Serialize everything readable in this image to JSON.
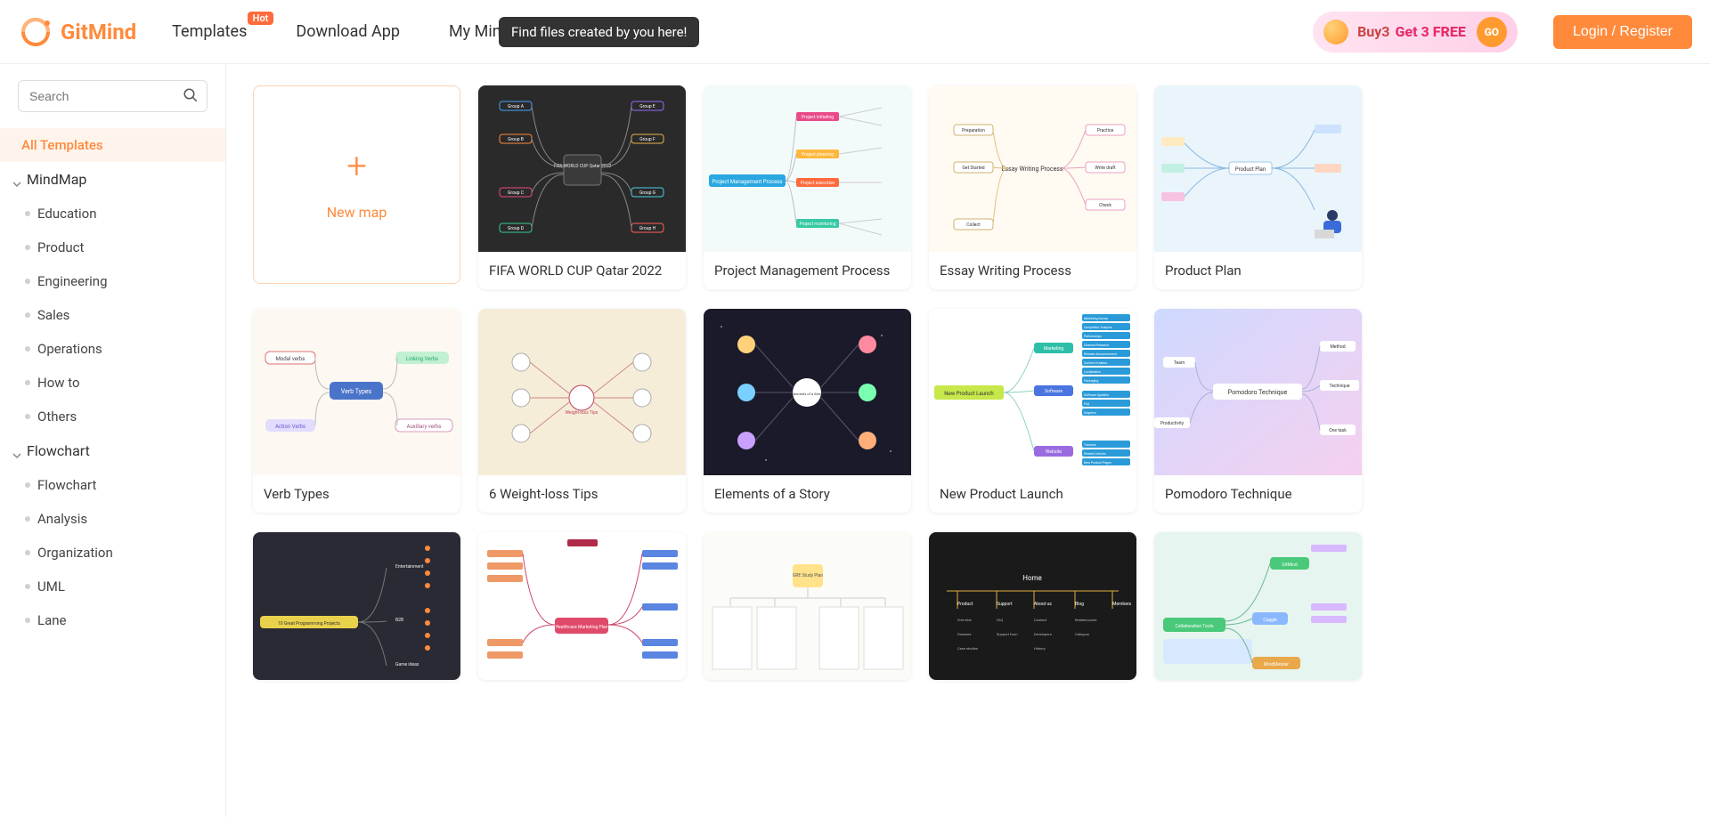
{
  "header": {
    "brand": "GitMind",
    "nav": {
      "templates": "Templates",
      "templates_badge": "Hot",
      "download": "Download App",
      "my_mind": "My Mind Maps"
    },
    "tooltip": "Find files created by you here!",
    "promo": {
      "part1": "Buy3",
      "part2": "Get 3 FREE",
      "go": "GO"
    },
    "login": "Login / Register"
  },
  "sidebar": {
    "search_placeholder": "Search",
    "all_templates": "All Templates",
    "groups": [
      {
        "name": "MindMap",
        "items": [
          "Education",
          "Product",
          "Engineering",
          "Sales",
          "Operations",
          "How to",
          "Others"
        ]
      },
      {
        "name": "Flowchart",
        "items": [
          "Flowchart",
          "Analysis",
          "Organization",
          "UML",
          "Lane"
        ]
      }
    ]
  },
  "grid": {
    "new_map": "New map",
    "cards_row1": [
      "FIFA WORLD CUP Qatar 2022",
      "Project Management Process",
      "Essay Writing Process",
      "Product Plan"
    ],
    "cards_row2": [
      "Verb Types",
      "6 Weight-loss Tips",
      "Elements of a Story",
      "New Product Launch",
      "Pomodoro Technique"
    ]
  },
  "thumbs": {
    "t1": {
      "center": "FIFA WORLD CUP\nQatar 2022",
      "left": [
        "Group A",
        "Group B",
        "Group C",
        "Group D"
      ],
      "right": [
        "Group E",
        "Group F",
        "Group G",
        "Group H"
      ]
    },
    "t2": {
      "center": "Project Management Process",
      "nodes": [
        "Project initiating",
        "Project planning",
        "Project execution",
        "Project monitoring"
      ]
    },
    "t3": {
      "center": "Essay Writing Process",
      "left": [
        "Preparation",
        "Get Started",
        "Collect"
      ],
      "right": [
        "Practice",
        "Write draft",
        "Check"
      ]
    },
    "t4": {
      "center": "Product Plan"
    },
    "t5": {
      "center": "Verb Types",
      "nodes": [
        "Modal verbs",
        "Linking Verbs",
        "Action Verbs",
        "Auxiliary verbs"
      ]
    },
    "t6": {
      "center": "Weight-loss Tips"
    },
    "t7": {
      "center": "Elements of a Story"
    },
    "t8": {
      "center": "New Product Launch",
      "branches": [
        "Marketing",
        "Software",
        "Website"
      ],
      "marketing_items": [
        "Marketing Survey",
        "Competitor Analysis",
        "Partnerships",
        "Channel Research",
        "Release Announcement",
        "Content Creation",
        "Localisation",
        "Packaging"
      ],
      "software_items": [
        "Software Updates",
        "FAQ",
        "Graphics"
      ],
      "website_items": [
        "Tutorials",
        "Related Articles",
        "New Product Pages"
      ]
    },
    "t9": {
      "center": "Pomodoro Technique",
      "nodes": [
        "Team",
        "Method",
        "One task",
        "Technique",
        "Productivity"
      ]
    },
    "t10": {
      "center": "10 Great Programming Projects",
      "branches": [
        "Entertainment",
        "B2B",
        "Game ideas"
      ]
    },
    "t11": {
      "center": "Healthcare Marketing Plan"
    },
    "t12": {
      "center": "GRE\nStudy Plan"
    },
    "t13": {
      "center": "Home",
      "cols": [
        "Product",
        "Support",
        "About us",
        "Blog",
        "Members"
      ],
      "rows": [
        [
          "Free trial",
          "FAQ",
          "Contact",
          "Related posts",
          ""
        ],
        [
          "Features",
          "Support form",
          "Developers",
          "Category",
          ""
        ],
        [
          "Case studies",
          "",
          "History",
          "",
          ""
        ]
      ]
    },
    "t14": {
      "nodes": [
        "GitMind",
        "Coggle",
        "MindMeister",
        "Collaboration Tools"
      ]
    }
  }
}
